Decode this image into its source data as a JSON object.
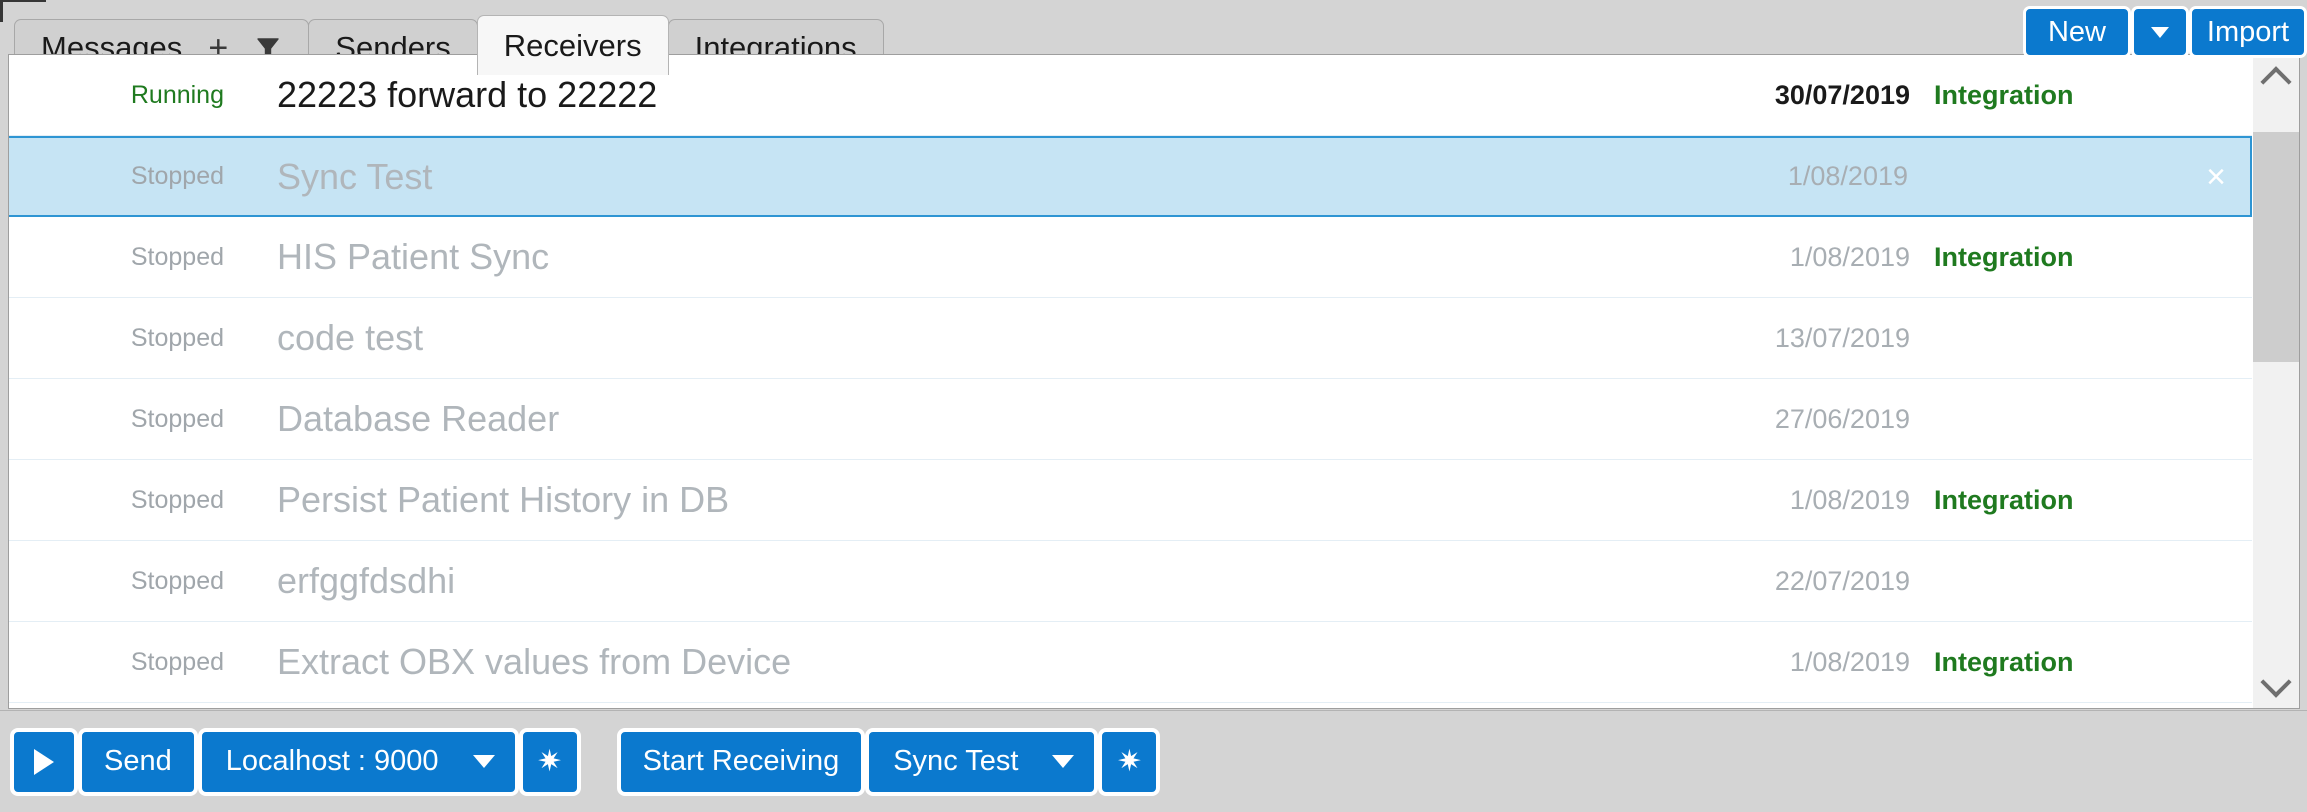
{
  "window": {
    "background_color": "#d4d4d4",
    "accent_color": "#0b79ce",
    "selected_row_color": "#c6e4f4",
    "running_color": "#1f7a1f"
  },
  "tabs": [
    {
      "label": "Messages",
      "active": false,
      "icons": [
        "plus-icon",
        "filter-icon"
      ]
    },
    {
      "label": "Senders",
      "active": false,
      "icons": []
    },
    {
      "label": "Receivers",
      "active": true,
      "icons": []
    },
    {
      "label": "Integrations",
      "active": false,
      "icons": []
    }
  ],
  "top_actions": {
    "new_label": "New",
    "new_dropdown_icon": "chevron-down-icon",
    "import_label": "Import"
  },
  "list": {
    "columns": [
      "status",
      "name",
      "date",
      "type"
    ],
    "rows": [
      {
        "status": "Running",
        "name": "22223 forward to 22222",
        "date": "30/07/2019",
        "type": "Integration",
        "selected": false,
        "first": true
      },
      {
        "status": "Stopped",
        "name": "Sync Test",
        "date": "1/08/2019",
        "type": "",
        "selected": true,
        "first": false
      },
      {
        "status": "Stopped",
        "name": "HIS Patient Sync",
        "date": "1/08/2019",
        "type": "Integration",
        "selected": false,
        "first": false
      },
      {
        "status": "Stopped",
        "name": "code test",
        "date": "13/07/2019",
        "type": "",
        "selected": false,
        "first": false
      },
      {
        "status": "Stopped",
        "name": "Database Reader",
        "date": "27/06/2019",
        "type": "",
        "selected": false,
        "first": false
      },
      {
        "status": "Stopped",
        "name": "Persist Patient History in DB",
        "date": "1/08/2019",
        "type": "Integration",
        "selected": false,
        "first": false
      },
      {
        "status": "Stopped",
        "name": "erfggfdsdhi",
        "date": "22/07/2019",
        "type": "",
        "selected": false,
        "first": false
      },
      {
        "status": "Stopped",
        "name": "Extract OBX values from Device",
        "date": "1/08/2019",
        "type": "Integration",
        "selected": false,
        "first": false
      }
    ],
    "close_glyph": "×",
    "scrollbar": {
      "up_icon": "chevron-up-icon",
      "down_icon": "chevron-down-icon"
    }
  },
  "bottom_bar": {
    "send_group": {
      "play_icon": "play-icon",
      "send_label": "Send",
      "endpoint_value": "Localhost : 9000",
      "endpoint_caret_icon": "chevron-down-icon",
      "settings_icon": "gear-icon"
    },
    "receive_group": {
      "start_receiving_label": "Start Receiving",
      "receiver_value": "Sync Test",
      "receiver_caret_icon": "chevron-down-icon",
      "settings_icon": "gear-icon"
    },
    "gear_glyph": "✷"
  }
}
